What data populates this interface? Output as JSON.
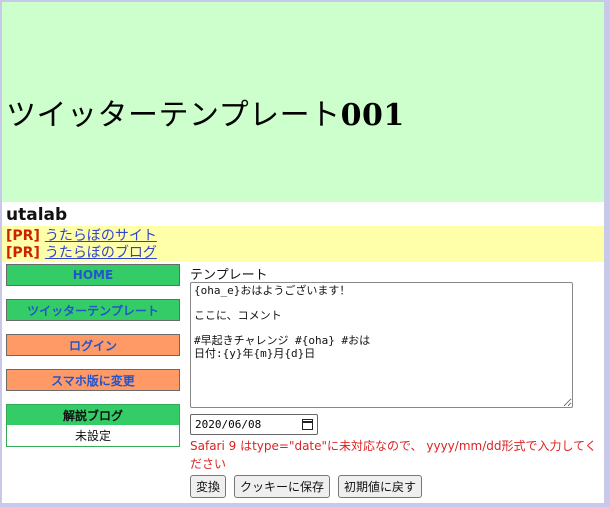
{
  "header": {
    "title_text": "ツイッターテンプレート",
    "title_number": "001"
  },
  "site_name": "utalab",
  "pr_links": [
    {
      "tag": "[PR]",
      "text": "うたらぼのサイト"
    },
    {
      "tag": "[PR]",
      "text": "うたらぼのブログ"
    }
  ],
  "sidebar": {
    "home": "HOME",
    "twitter_template": "ツイッターテンプレート",
    "login": "ログイン",
    "mobile": "スマホ版に変更",
    "blog_title": "解説ブログ",
    "blog_value": "未設定"
  },
  "form": {
    "template_label": "テンプレート",
    "template_value": "{oha_e}おはようございます！\n\nここに、コメント\n\n#早起きチャレンジ #{oha} #おは\n日付:{y}年{m}月{d}日",
    "date_value": "2020/06/08",
    "warning": "Safari 9 はtype=\"date\"に未対応なので、 yyyy/mm/dd形式で入力してください",
    "buttons": {
      "convert": "変換",
      "save_cookie": "クッキーに保存",
      "reset": "初期値に戻す"
    }
  },
  "colors": {
    "header_bg": "#ccffcc",
    "pr_bg": "#ffffaa",
    "green": "#33cc66",
    "orange": "#ff9966",
    "warning": "#dd2222"
  }
}
